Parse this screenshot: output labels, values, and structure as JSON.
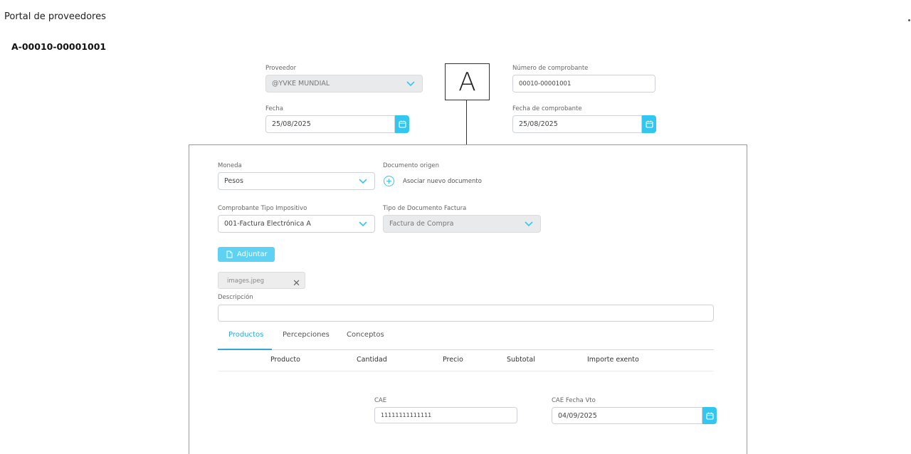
{
  "header": {
    "portal_title": "Portal de proveedores",
    "document_id": "A-00010-00001001"
  },
  "annotation": {
    "letter": "A"
  },
  "top_form": {
    "proveedor": {
      "label": "Proveedor",
      "value": "@YVKE MUNDIAL",
      "disabled": true
    },
    "numero": {
      "label": "Número de comprobante",
      "value": "00010-00001001"
    },
    "fecha": {
      "label": "Fecha",
      "value": "25/08/2025"
    },
    "fecha_comprobante": {
      "label": "Fecha de comprobante",
      "value": "25/08/2025"
    }
  },
  "panel": {
    "moneda": {
      "label": "Moneda",
      "value": "Pesos"
    },
    "documento_origen": {
      "label": "Documento origen",
      "link": "Asociar nuevo documento"
    },
    "comprobante_tipo": {
      "label": "Comprobante Tipo Impositivo",
      "value": "001-Factura Electrónica A"
    },
    "tipo_documento": {
      "label": "Tipo de Documento Factura",
      "value": "Factura de Compra",
      "disabled": true
    },
    "attach_button": "Adjuntar",
    "file_chip": "images.jpeg",
    "descripcion": {
      "label": "Descripción",
      "value": ""
    },
    "tabs": [
      {
        "label": "Productos",
        "active": true
      },
      {
        "label": "Percepciones",
        "active": false
      },
      {
        "label": "Conceptos",
        "active": false
      }
    ],
    "table_headers": [
      "Producto",
      "Cantidad",
      "Precio",
      "Subtotal",
      "Importe exento"
    ],
    "cae": {
      "label": "CAE",
      "value": "11111111111111"
    },
    "cae_fecha": {
      "label": "CAE Fecha Vto",
      "value": "04/09/2025"
    }
  },
  "colors": {
    "accent": "#33c7f0",
    "tab_active": "#2ea8dc",
    "disabled_bg": "#e9eaec"
  }
}
